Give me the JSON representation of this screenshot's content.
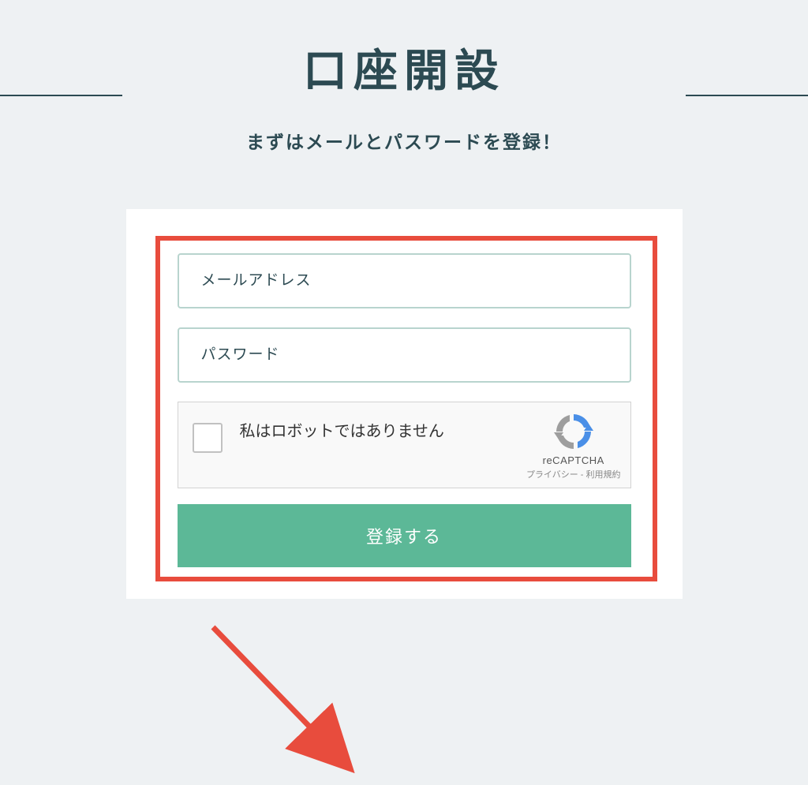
{
  "header": {
    "title": "口座開設",
    "subtitle": "まずはメールとパスワードを登録！"
  },
  "form": {
    "email_placeholder": "メールアドレス",
    "password_placeholder": "パスワード",
    "recaptcha": {
      "label": "私はロボットではありません",
      "brand": "reCAPTCHA",
      "links": "プライバシー - 利用規約"
    },
    "submit_label": "登録する"
  },
  "colors": {
    "primary_text": "#2c4a52",
    "accent_green": "#5cb897",
    "highlight_red": "#e84c3d",
    "input_border": "#b8d4ce",
    "background": "#eef1f3"
  }
}
